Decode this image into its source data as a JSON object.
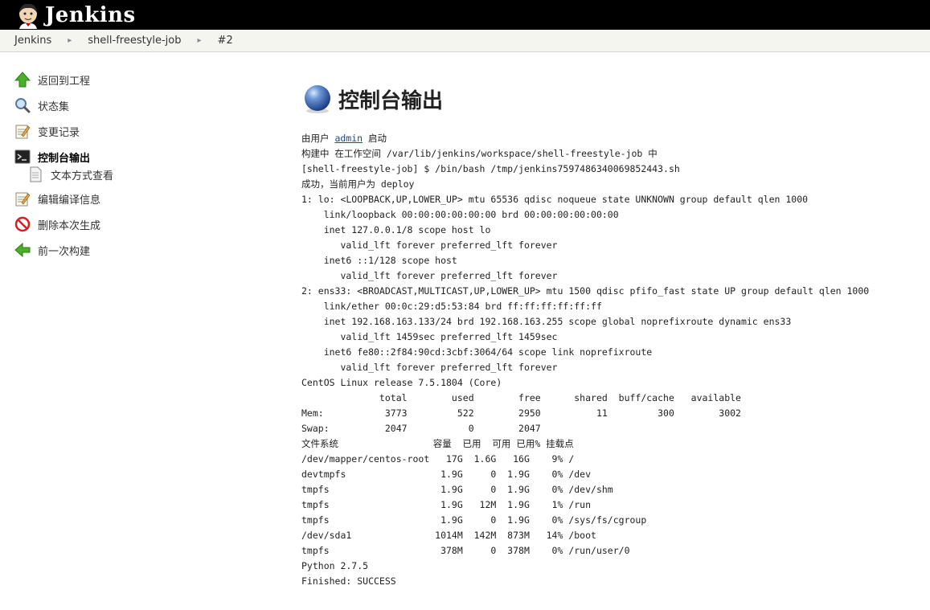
{
  "header": {
    "brand": "Jenkins"
  },
  "breadcrumb": [
    {
      "label": "Jenkins"
    },
    {
      "label": "shell-freestyle-job"
    },
    {
      "label": "#2"
    }
  ],
  "sidebar": {
    "items": [
      {
        "label": "返回到工程",
        "icon": "up-arrow-icon"
      },
      {
        "label": "状态集",
        "icon": "magnifier-icon"
      },
      {
        "label": "变更记录",
        "icon": "notepad-icon"
      },
      {
        "label": "控制台输出",
        "icon": "terminal-icon",
        "active": true
      },
      {
        "label": "文本方式查看",
        "icon": "document-icon",
        "sub": true
      },
      {
        "label": "编辑编译信息",
        "icon": "notepad-icon"
      },
      {
        "label": "删除本次生成",
        "icon": "no-entry-icon"
      },
      {
        "label": "前一次构建",
        "icon": "left-arrow-icon"
      }
    ]
  },
  "main": {
    "title": "控制台输出"
  },
  "console": {
    "started_prefix": "由用户 ",
    "started_user": "admin",
    "started_suffix": " 启动",
    "lines": [
      "构建中 在工作空间 /var/lib/jenkins/workspace/shell-freestyle-job 中",
      "[shell-freestyle-job] $ /bin/bash /tmp/jenkins7597486340069852443.sh",
      "成功，当前用户为 deploy",
      "1: lo: <LOOPBACK,UP,LOWER_UP> mtu 65536 qdisc noqueue state UNKNOWN group default qlen 1000",
      "    link/loopback 00:00:00:00:00:00 brd 00:00:00:00:00:00",
      "    inet 127.0.0.1/8 scope host lo",
      "       valid_lft forever preferred_lft forever",
      "    inet6 ::1/128 scope host",
      "       valid_lft forever preferred_lft forever",
      "2: ens33: <BROADCAST,MULTICAST,UP,LOWER_UP> mtu 1500 qdisc pfifo_fast state UP group default qlen 1000",
      "    link/ether 00:0c:29:d5:53:84 brd ff:ff:ff:ff:ff:ff",
      "    inet 192.168.163.133/24 brd 192.168.163.255 scope global noprefixroute dynamic ens33",
      "       valid_lft 1459sec preferred_lft 1459sec",
      "    inet6 fe80::2f84:90cd:3cbf:3064/64 scope link noprefixroute",
      "       valid_lft forever preferred_lft forever",
      "CentOS Linux release 7.5.1804 (Core)",
      "              total        used        free      shared  buff/cache   available",
      "Mem:           3773         522        2950          11         300        3002",
      "Swap:          2047           0        2047",
      "文件系统                 容量  已用  可用 已用% 挂载点",
      "/dev/mapper/centos-root   17G  1.6G   16G    9% /",
      "devtmpfs                 1.9G     0  1.9G    0% /dev",
      "tmpfs                    1.9G     0  1.9G    0% /dev/shm",
      "tmpfs                    1.9G   12M  1.9G    1% /run",
      "tmpfs                    1.9G     0  1.9G    0% /sys/fs/cgroup",
      "/dev/sda1               1014M  142M  873M   14% /boot",
      "tmpfs                    378M     0  378M    0% /run/user/0",
      "Python 2.7.5",
      "Finished: SUCCESS"
    ]
  }
}
